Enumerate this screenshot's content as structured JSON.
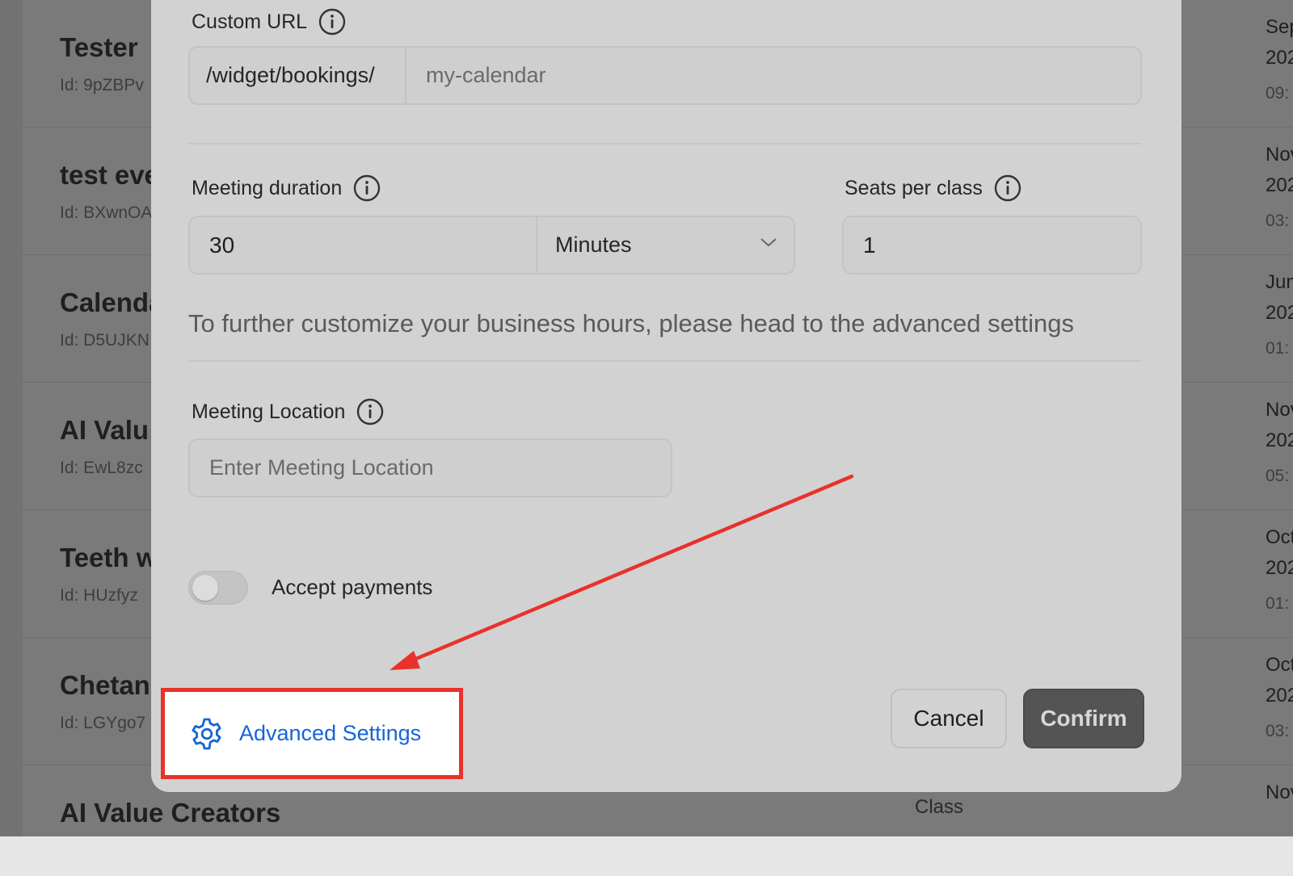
{
  "background": {
    "rows": [
      {
        "title": "Tester",
        "id": "Id: 9pZBPv",
        "date1": "Sep",
        "date2": "202",
        "time": "09:"
      },
      {
        "title": "test eve",
        "id": "Id: BXwnOA",
        "date1": "Nov",
        "date2": "202",
        "time": "03:"
      },
      {
        "title": "Calenda",
        "id": "Id: D5UJKN",
        "date1": "Jun",
        "date2": "202",
        "time": "01:"
      },
      {
        "title": "AI Valu",
        "id": "Id: EwL8zc",
        "date1": "Nov",
        "date2": "202",
        "time": "05:"
      },
      {
        "title": "Teeth w",
        "id": "Id: HUzfyz",
        "date1": "Oct",
        "date2": "202",
        "time": "01:"
      },
      {
        "title": "Chetan",
        "id": "Id: LGYgo7",
        "date1": "Oct",
        "date2": "202",
        "time": "03:"
      },
      {
        "title": "AI Value Creators",
        "id": "",
        "date1": "Nov",
        "date2": "",
        "time": "",
        "type": "Class"
      }
    ]
  },
  "modal": {
    "custom_url": {
      "label": "Custom URL",
      "prefix": "/widget/bookings/",
      "value": "my-calendar"
    },
    "meeting_duration": {
      "label": "Meeting duration",
      "value": "30",
      "unit": "Minutes"
    },
    "seats_per_class": {
      "label": "Seats per class",
      "value": "1"
    },
    "help_text": "To further customize your business hours, please head to the advanced settings",
    "meeting_location": {
      "label": "Meeting Location",
      "placeholder": "Enter Meeting Location"
    },
    "accept_payments": {
      "label": "Accept payments",
      "enabled": false
    },
    "advanced_settings_label": "Advanced Settings",
    "cancel_label": "Cancel",
    "confirm_label": "Confirm"
  },
  "annotation": {
    "highlight_color": "#e8322b",
    "arrow_color": "#e8322b"
  },
  "colors": {
    "link_blue": "#1565d8",
    "confirm_bg": "#545454"
  }
}
